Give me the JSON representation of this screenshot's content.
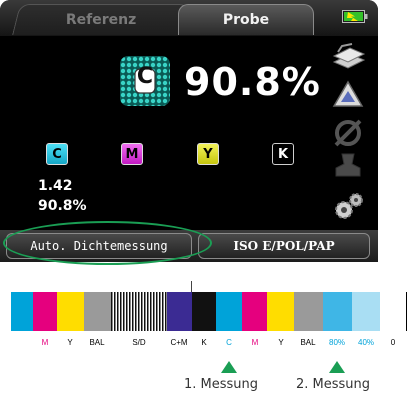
{
  "tabs": {
    "reference_label": "Referenz",
    "sample_label": "Probe"
  },
  "main": {
    "patch_letter": "C",
    "density_percent": "90.8%"
  },
  "channels": [
    {
      "letter": "C"
    },
    {
      "letter": "M"
    },
    {
      "letter": "Y"
    },
    {
      "letter": "K"
    }
  ],
  "readout": {
    "density": "1.42",
    "percent": "90.8%"
  },
  "bottom_buttons": {
    "auto_label": "Auto. Dichtemessung",
    "standard_label": "ISO E/POL/PAP"
  },
  "colors": {
    "accent_green": "#1a9e54",
    "cyan": "#00a3d9",
    "magenta": "#e5007e",
    "yellow": "#ffdd00",
    "gray": "#9a9a9a",
    "blue_violet": "#3b2b93",
    "black": "#111111",
    "tint_80": "#3fb6e6",
    "tint_40": "#a9def3"
  },
  "color_bar": {
    "labels": [
      {
        "text": "M",
        "color": "#e5007e"
      },
      {
        "text": "Y",
        "color": "#000000"
      },
      {
        "text": "BAL",
        "color": "#000000"
      },
      {
        "text": "S/D",
        "color": "#000000"
      },
      {
        "text": "C+M",
        "color": "#000000"
      },
      {
        "text": "K",
        "color": "#000000"
      },
      {
        "text": "C",
        "color": "#00a3d9"
      },
      {
        "text": "M",
        "color": "#e5007e"
      },
      {
        "text": "Y",
        "color": "#000000"
      },
      {
        "text": "BAL",
        "color": "#000000"
      },
      {
        "text": "80%",
        "color": "#00a3d9"
      },
      {
        "text": "40%",
        "color": "#00a3d9"
      },
      {
        "text": "0",
        "color": "#000000"
      }
    ]
  },
  "measurements": {
    "first": "1. Messung",
    "second": "2. Messung"
  }
}
